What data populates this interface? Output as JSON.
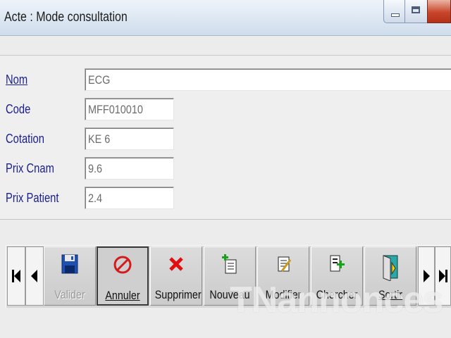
{
  "window": {
    "title": "Acte  : Mode consultation"
  },
  "form": {
    "fields": [
      {
        "label": "Nom",
        "value": "ECG"
      },
      {
        "label": "Code",
        "value": "MFF010010"
      },
      {
        "label": "Cotation",
        "value": "KE 6"
      },
      {
        "label": "Prix Cnam",
        "value": "9.6"
      },
      {
        "label": "Prix Patient",
        "value": "2.4"
      }
    ]
  },
  "toolbar": {
    "buttons": [
      {
        "label": "Valider",
        "icon": "floppy-disk-icon",
        "enabled": false
      },
      {
        "label": "Annuler",
        "icon": "cancel-circle-icon",
        "pressed": true
      },
      {
        "label": "Supprimer",
        "icon": "red-x-icon"
      },
      {
        "label": "Nouveau",
        "icon": "new-document-icon"
      },
      {
        "label": "Modifier",
        "icon": "edit-document-icon"
      },
      {
        "label": "Chercher",
        "icon": "search-list-icon"
      },
      {
        "label": "Sortir",
        "icon": "exit-door-icon"
      }
    ]
  },
  "watermark": "TNannonces",
  "colors": {
    "label_text": "#1a1f8c",
    "field_text": "#6b6b6b",
    "toolbar_bg": "#d6d6d6"
  }
}
